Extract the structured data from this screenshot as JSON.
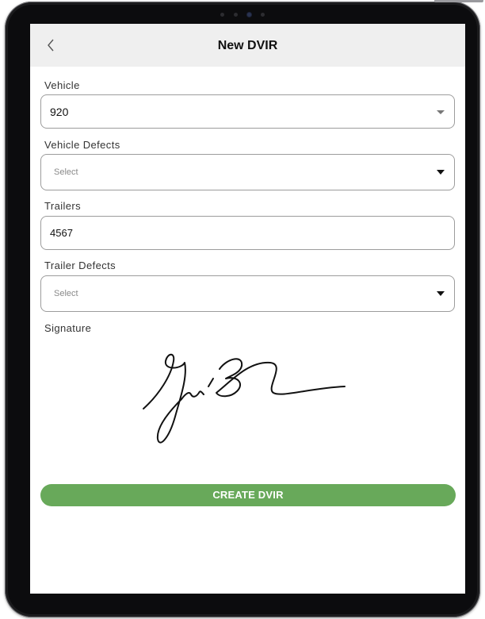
{
  "nav": {
    "title": "New DVIR",
    "back_icon": "chevron-left-icon"
  },
  "form": {
    "vehicle": {
      "label": "Vehicle",
      "value": "920"
    },
    "vehicle_defects": {
      "label": "Vehicle Defects",
      "placeholder": "Select"
    },
    "trailers": {
      "label": "Trailers",
      "value": "4567"
    },
    "trailer_defects": {
      "label": "Trailer Defects",
      "placeholder": "Select"
    },
    "signature": {
      "label": "Signature"
    }
  },
  "actions": {
    "create_label": "CREATE DVIR"
  },
  "colors": {
    "accent_green": "#68a95a",
    "navbar_bg": "#efefef",
    "device_frame": "#1b1b1d"
  }
}
